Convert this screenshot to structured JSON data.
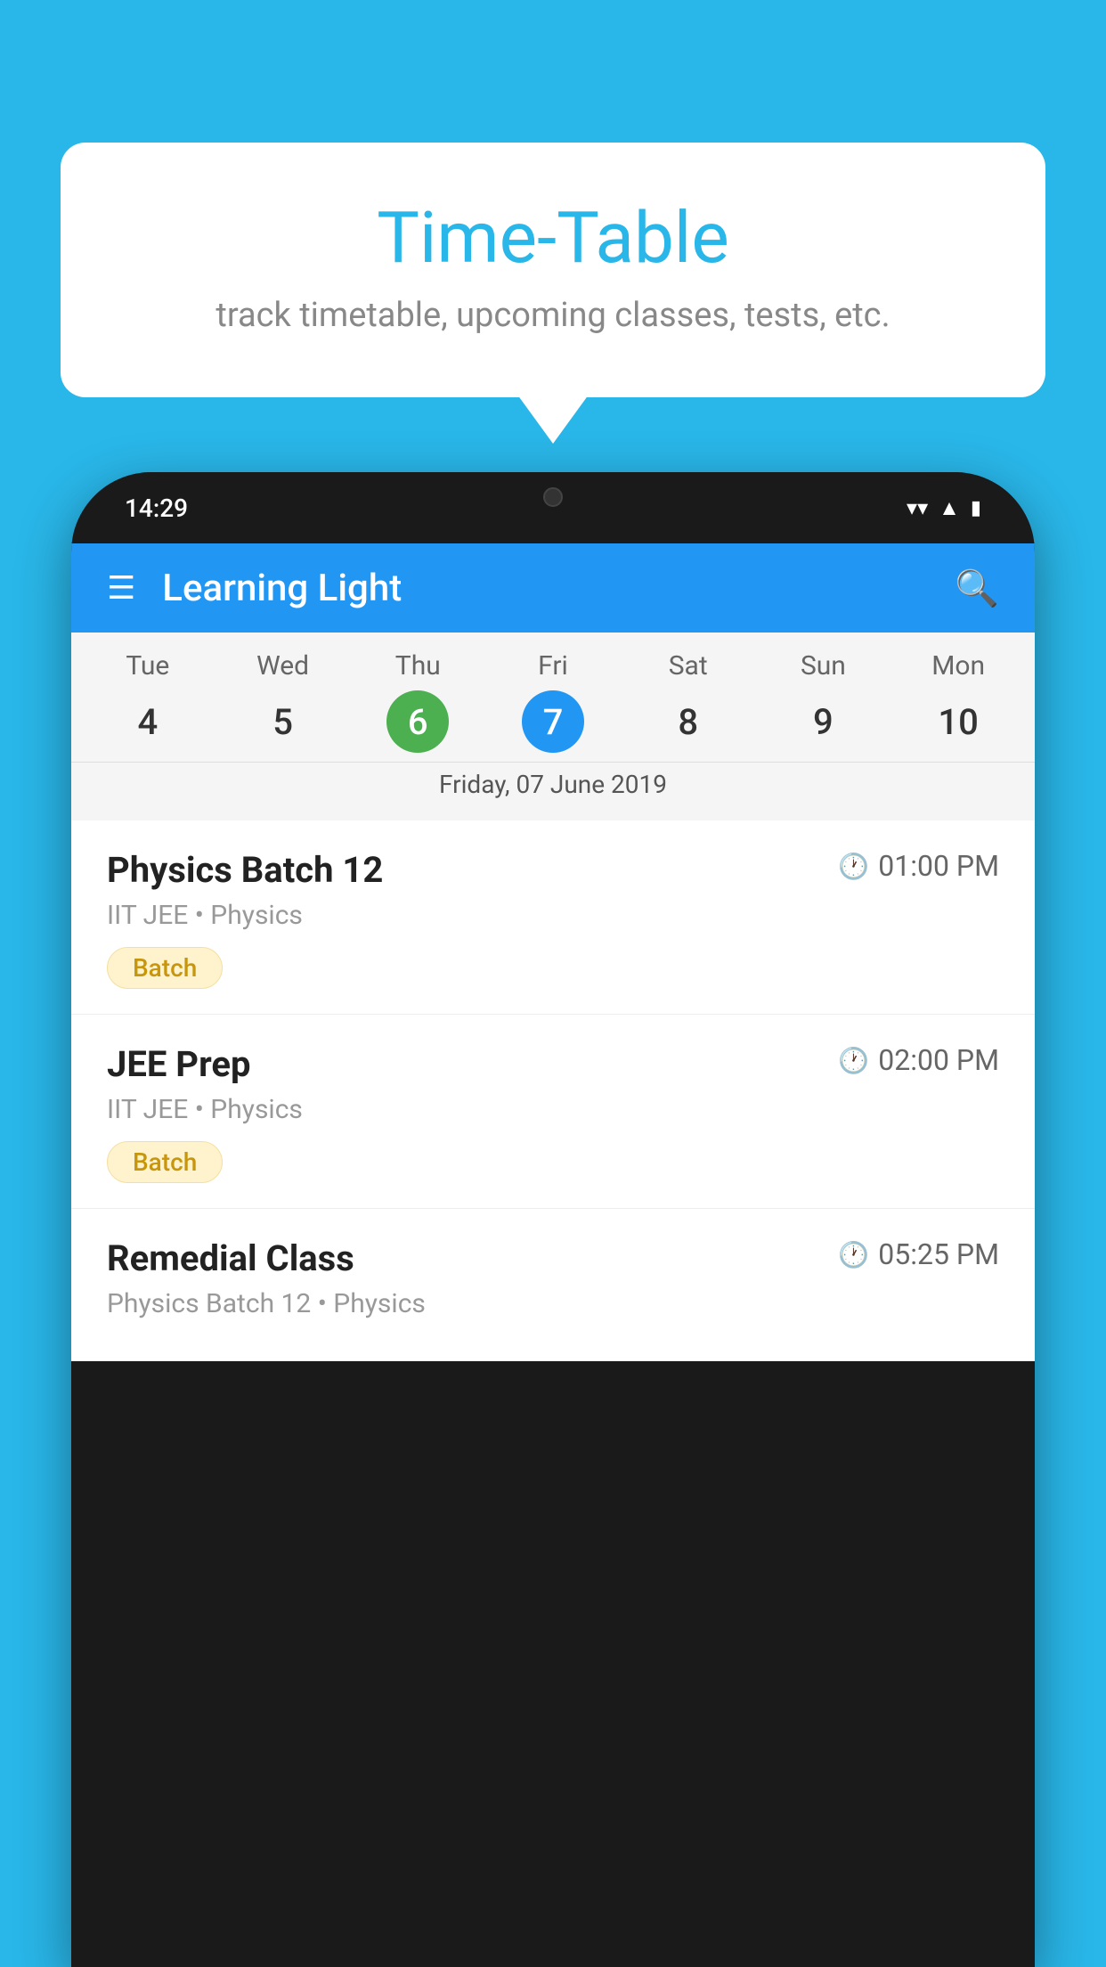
{
  "background_color": "#29B6E8",
  "bubble": {
    "title": "Time-Table",
    "subtitle": "track timetable, upcoming classes, tests, etc."
  },
  "phone": {
    "status_bar": {
      "time": "14:29",
      "wifi_icon": "wifi",
      "signal_icon": "signal",
      "battery_icon": "battery"
    },
    "app_bar": {
      "title": "Learning Light",
      "menu_icon": "hamburger",
      "search_icon": "search"
    },
    "calendar": {
      "days": [
        {
          "label": "Tue",
          "num": "4"
        },
        {
          "label": "Wed",
          "num": "5"
        },
        {
          "label": "Thu",
          "num": "6",
          "state": "today"
        },
        {
          "label": "Fri",
          "num": "7",
          "state": "selected"
        },
        {
          "label": "Sat",
          "num": "8"
        },
        {
          "label": "Sun",
          "num": "9"
        },
        {
          "label": "Mon",
          "num": "10"
        }
      ],
      "selected_date_label": "Friday, 07 June 2019"
    },
    "schedule": [
      {
        "title": "Physics Batch 12",
        "time": "01:00 PM",
        "meta": "IIT JEE • Physics",
        "badge": "Batch"
      },
      {
        "title": "JEE Prep",
        "time": "02:00 PM",
        "meta": "IIT JEE • Physics",
        "badge": "Batch"
      },
      {
        "title": "Remedial Class",
        "time": "05:25 PM",
        "meta": "Physics Batch 12 • Physics",
        "badge": ""
      }
    ]
  }
}
